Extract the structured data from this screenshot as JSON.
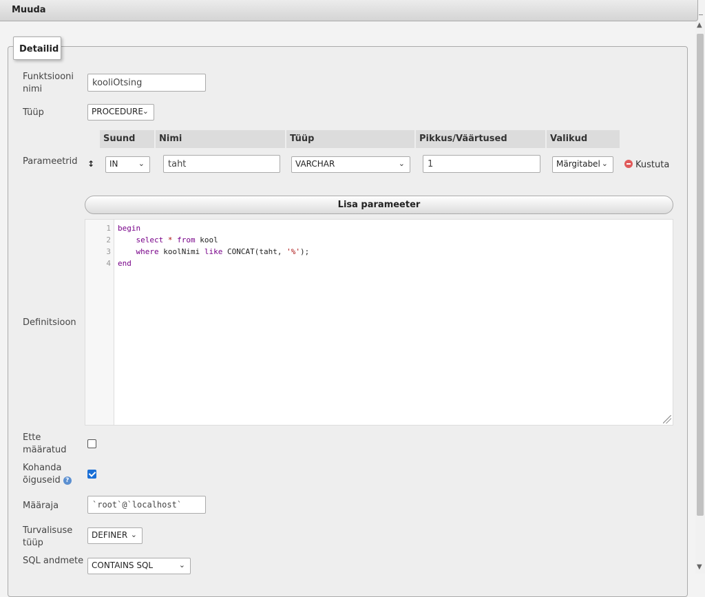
{
  "dialog": {
    "title": "Muuda"
  },
  "fieldset": {
    "legend": "Detailid"
  },
  "labels": {
    "function_name": "Funktsiooni nimi",
    "type": "Tüüp",
    "parameters": "Parameetrid",
    "definition": "Definitsioon",
    "deterministic": "Ette määratud",
    "adjust_privileges": "Kohanda õiguseid",
    "definer": "Määraja",
    "security_type": "Turvalisuse tüüp",
    "sql_data_access": "SQL andmete"
  },
  "fields": {
    "function_name": "kooliOtsing",
    "type": "PROCEDURE",
    "definer": "`root`@`localhost`",
    "security_type": "DEFINER",
    "sql_data_access": "CONTAINS SQL"
  },
  "params_table": {
    "headers": [
      "Suund",
      "Nimi",
      "Tüüp",
      "Pikkus/Väärtused",
      "Valikud"
    ],
    "row": {
      "direction": "IN",
      "name": "taht",
      "type": "VARCHAR",
      "length": "1",
      "options": "Märgitabel",
      "delete_label": "Kustuta"
    }
  },
  "add_param_label": "Lisa parameeter",
  "code": {
    "line_numbers": [
      "1",
      "2",
      "3",
      "4"
    ]
  },
  "checkboxes": {
    "deterministic": false,
    "adjust_privileges": true
  }
}
